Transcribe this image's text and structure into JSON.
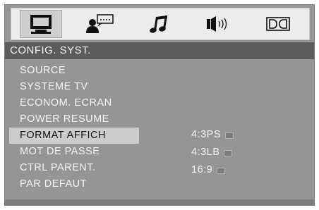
{
  "tabs": [
    {
      "icon": "monitor-icon",
      "selected": true
    },
    {
      "icon": "speech-person-icon",
      "selected": false
    },
    {
      "icon": "music-note-icon",
      "selected": false
    },
    {
      "icon": "speaker-icon",
      "selected": false
    },
    {
      "icon": "dolby-icon",
      "selected": false
    }
  ],
  "header": {
    "title": "CONFIG. SYST."
  },
  "menu": {
    "items": [
      {
        "label": "SOURCE"
      },
      {
        "label": "SYSTEME TV"
      },
      {
        "label": "ECONOM. ECRAN"
      },
      {
        "label": "POWER RESUME"
      },
      {
        "label": "FORMAT AFFICH"
      },
      {
        "label": "MOT DE PASSE"
      },
      {
        "label": "CTRL PARENT."
      },
      {
        "label": "PAR DEFAUT"
      }
    ],
    "selected_label": "FORMAT AFFICH"
  },
  "options": {
    "items": [
      {
        "label": "4:3PS"
      },
      {
        "label": "4:3LB"
      },
      {
        "label": "16:9"
      }
    ]
  },
  "colors": {
    "panel": "#959595",
    "header_bar": "#5c5c5c",
    "selected_item": "#cccccc",
    "text": "#f4f4f4"
  }
}
